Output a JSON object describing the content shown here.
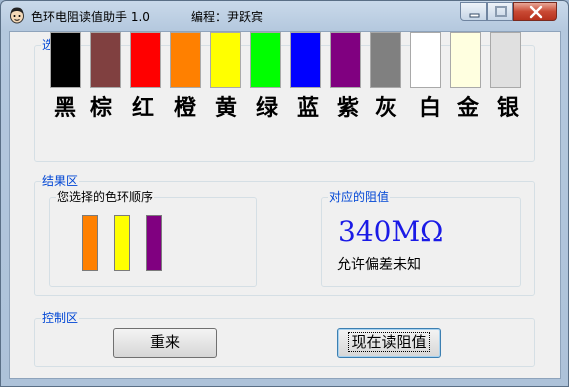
{
  "window": {
    "title": "色环电阻读值助手 1.0",
    "author": "编程：尹跃宾"
  },
  "select_group": {
    "label": "选择区",
    "colors": [
      {
        "name": "黑",
        "hex": "#000000"
      },
      {
        "name": "棕",
        "hex": "#804040"
      },
      {
        "name": "红",
        "hex": "#ff0000"
      },
      {
        "name": "橙",
        "hex": "#ff8000"
      },
      {
        "name": "黄",
        "hex": "#ffff00"
      },
      {
        "name": "绿",
        "hex": "#00ff00"
      },
      {
        "name": "蓝",
        "hex": "#0000ff"
      },
      {
        "name": "紫",
        "hex": "#800080"
      },
      {
        "name": "灰",
        "hex": "#808080"
      },
      {
        "name": "白",
        "hex": "#ffffff"
      },
      {
        "name": "金",
        "hex": "#ffffe0"
      },
      {
        "name": "银",
        "hex": "#e0e0e0"
      }
    ]
  },
  "result_group": {
    "label": "结果区",
    "sequence": {
      "label": "您选择的色环顺序",
      "bands": [
        "#ff8000",
        "#ffff00",
        "#800080"
      ]
    },
    "resistance": {
      "label": "对应的阻值",
      "value": "340MΩ",
      "tolerance": "允许偏差未知"
    }
  },
  "control_group": {
    "label": "控制区",
    "reset_button": "重来",
    "read_button": "现在读阻值"
  }
}
